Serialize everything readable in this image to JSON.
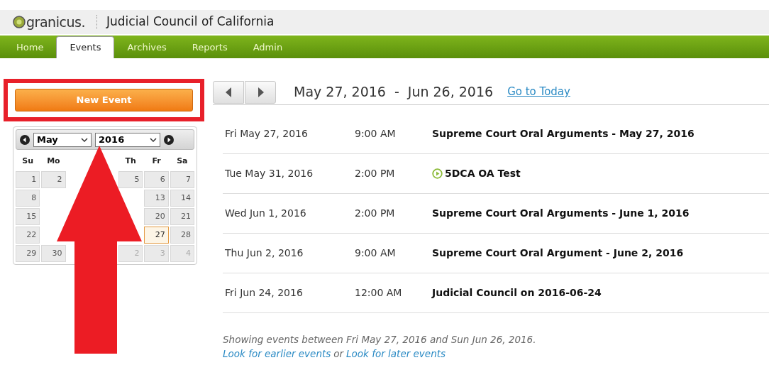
{
  "header": {
    "logo_text": "granicus.",
    "title": "Judicial Council of California"
  },
  "nav_tabs": [
    {
      "label": "Home",
      "selected": false
    },
    {
      "label": "Events",
      "selected": true
    },
    {
      "label": "Archives",
      "selected": false
    },
    {
      "label": "Reports",
      "selected": false
    },
    {
      "label": "Admin",
      "selected": false
    }
  ],
  "new_event_button": "New Event",
  "calendar": {
    "month": "May",
    "year": "2016",
    "weekdays": {
      "left": [
        "Su",
        "Mo"
      ],
      "right": [
        "Th",
        "Fr",
        "Sa"
      ]
    },
    "weeks": [
      {
        "left": [
          {
            "day": "1",
            "other_month": false,
            "selected": false
          },
          {
            "day": "2",
            "other_month": false,
            "selected": false
          }
        ],
        "right": [
          {
            "day": "5",
            "other_month": false,
            "selected": false
          },
          {
            "day": "6",
            "other_month": false,
            "selected": false
          },
          {
            "day": "7",
            "other_month": false,
            "selected": false
          }
        ]
      },
      {
        "left": [
          {
            "day": "8",
            "other_month": false,
            "selected": false
          }
        ],
        "right": [
          {
            "day": "13",
            "other_month": false,
            "selected": false
          },
          {
            "day": "14",
            "other_month": false,
            "selected": false
          }
        ]
      },
      {
        "left": [
          {
            "day": "15",
            "other_month": false,
            "selected": false
          }
        ],
        "right": [
          {
            "day": "20",
            "other_month": false,
            "selected": false
          },
          {
            "day": "21",
            "other_month": false,
            "selected": false
          }
        ]
      },
      {
        "left": [
          {
            "day": "22",
            "other_month": false,
            "selected": false
          }
        ],
        "right": [
          {
            "day": "27",
            "other_month": false,
            "selected": true
          },
          {
            "day": "28",
            "other_month": false,
            "selected": false
          }
        ]
      },
      {
        "left": [
          {
            "day": "29",
            "other_month": false,
            "selected": false
          },
          {
            "day": "30",
            "other_month": false,
            "selected": false
          }
        ],
        "right": [
          {
            "day": "2",
            "other_month": true,
            "selected": false
          },
          {
            "day": "3",
            "other_month": true,
            "selected": false
          },
          {
            "day": "4",
            "other_month": true,
            "selected": false
          }
        ]
      }
    ]
  },
  "range": {
    "start": "May 27, 2016",
    "separator": "-",
    "end": "Jun 26, 2016",
    "today_link": "Go to Today"
  },
  "events": [
    {
      "date": "Fri May 27, 2016",
      "time": "9:00 AM",
      "title": "Supreme Court Oral Arguments - May 27, 2016",
      "live": false
    },
    {
      "date": "Tue May 31, 2016",
      "time": "2:00 PM",
      "title": "5DCA OA Test",
      "live": true
    },
    {
      "date": "Wed Jun 1, 2016",
      "time": "2:00 PM",
      "title": "Supreme Court Oral Arguments - June 1, 2016",
      "live": false
    },
    {
      "date": "Thu Jun 2, 2016",
      "time": "9:00 AM",
      "title": "Supreme Court Oral Argument - June 2, 2016",
      "live": false
    },
    {
      "date": "Fri Jun 24, 2016",
      "time": "12:00 AM",
      "title": "Judicial Council on 2016-06-24",
      "live": false
    }
  ],
  "footer": {
    "summary": "Showing events between Fri May 27, 2016 and Sun Jun 26, 2016.",
    "earlier_link": "Look for earlier events",
    "joiner": "or",
    "later_link": "Look for later events"
  }
}
